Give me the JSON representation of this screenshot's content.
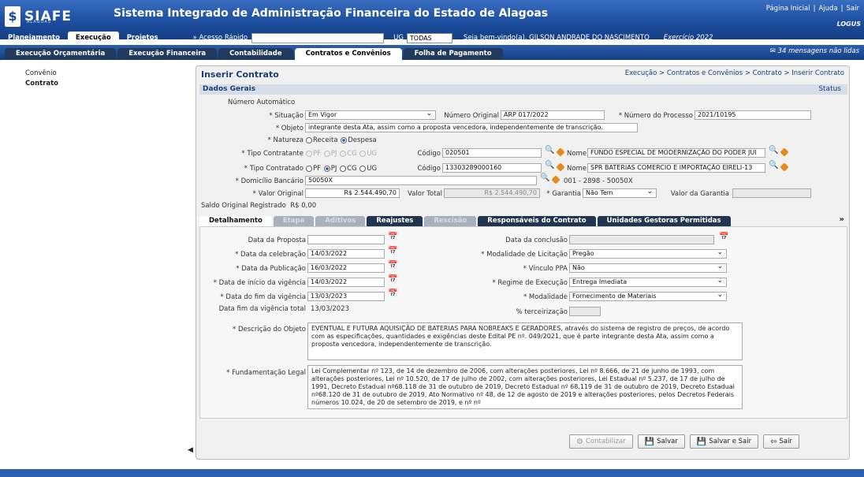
{
  "header": {
    "logo": "SIAFE",
    "logo_sub": "ALAGOAS",
    "title": "Sistema Integrado de Administração Financeira do Estado de Alagoas",
    "links": [
      "Página Inicial",
      "|",
      "Ajuda",
      "|",
      "Sair"
    ],
    "vendor": "LOGUS"
  },
  "menu": {
    "items": [
      "Planejamento",
      "Execução",
      "Projetos"
    ],
    "quick_access": "» Acesso Rápido",
    "ug_label": "UG",
    "ug_value": "TODAS",
    "welcome": "Seja bem-vindo(a), GILSON ANDRADE DO NASCIMENTO",
    "exercise": "Exercício 2022"
  },
  "tabs": [
    "Execução Orçamentária",
    "Execução Financeira",
    "Contabilidade",
    "Contratos e Convênios",
    "Folha de Pagamento"
  ],
  "messages": "34 mensagens não lidas",
  "leftnav": [
    "Convênio",
    "Contrato"
  ],
  "page": {
    "title": "Inserir Contrato",
    "breadcrumb": "Execução > Contratos e Convênios > Contrato > Inserir Contrato",
    "section": "Dados Gerais",
    "status_label": "Status"
  },
  "form": {
    "numero_auto": "Número Automático",
    "situacao_label": "* Situação",
    "situacao": "Em Vigor",
    "num_original_label": "Número Original",
    "num_original": "ARP 017/2022",
    "num_processo_label": "* Número do Processo",
    "num_processo": "2021/10195",
    "objeto_label": "* Objeto",
    "objeto": "integrante desta Ata, assim como a proposta vencedora, independentemente de transcrição.",
    "natureza_label": "* Natureza",
    "receita": "Receita",
    "despesa": "Despesa",
    "tipo_contratante_label": "* Tipo Contratante",
    "tipo_contratado_label": "* Tipo Contratado",
    "pf": "PF",
    "pj": "PJ",
    "cg": "CG",
    "ug": "UG",
    "codigo_label": "Código",
    "codigo1": "020501",
    "codigo2": "13303289000160",
    "nome_label": "Nome",
    "nome1": "FUNDO ESPECIAL DE MODERNIZAÇÃO DO PODER JUI",
    "nome2": "SPR BATERIAS COMERCIO E IMPORTAÇÃO EIRELI-13",
    "domicilio_label": "* Domicílio Bancário",
    "domicilio": "50050X",
    "domicilio_desc": "001 - 2898 - 50050X",
    "valor_original_label": "* Valor Original",
    "valor_original": "R$ 2.544.490,70",
    "valor_total_label": "Valor Total",
    "valor_total": "R$ 2.544.490,70",
    "garantia_label": "* Garantia",
    "garantia": "Não Tem",
    "valor_garantia_label": "Valor da Garantia",
    "saldo_label": "Saldo Original Registrado",
    "saldo": "R$ 0,00"
  },
  "subtabs": [
    "Detalhamento",
    "Etapa",
    "Aditivos",
    "Reajustes",
    "Rescisão",
    "Responsáveis do Contrato",
    "Unidades Gestoras Permitidas",
    "»"
  ],
  "detail": {
    "data_proposta_label": "Data da Proposta",
    "data_proposta": "",
    "data_celebracao_label": "* Data da celebração",
    "data_celebracao": "14/03/2022",
    "data_publicacao_label": "* Data da Publicação",
    "data_publicacao": "16/03/2022",
    "inicio_vigencia_label": "* Data de início da vigência",
    "inicio_vigencia": "14/03/2022",
    "fim_vigencia_label": "* Data do fim da vigência",
    "fim_vigencia": "13/03/2023",
    "fim_total_label": "Data fim da vigência total",
    "fim_total": "13/03/2023",
    "data_conclusao_label": "Data da conclusão",
    "data_conclusao": "",
    "modalidade_licitacao_label": "* Modalidade de Licitação",
    "modalidade_licitacao": "Pregão",
    "vinculo_ppa_label": "* Vínculo PPA",
    "vinculo_ppa": "Não",
    "regime_label": "* Regime de Execução",
    "regime": "Entrega Imediata",
    "modalidade_label": "* Modalidade",
    "modalidade": "Fornecimento de Materiais",
    "terceirizacao_label": "% terceirização",
    "terceirizacao": "",
    "descricao_label": "* Descrição do Objeto",
    "descricao": "EVENTUAL E FUTURA AQUISIÇÃO DE BATERIAS PARA NOBREAKS E GERADORES, através do sistema de registro de preços, de acordo com as especificações, quantidades e exigências deste Edital PE nº. 049/2021, que é parte integrante desta Ata, assim como a proposta vencedora, independentemente de transcrição.",
    "fundamentacao_label": "* Fundamentação Legal",
    "fundamentacao": "Lei Complementar nº 123, de 14 de dezembro de 2006, com alterações posteriores, Lei nº 8.666, de 21 de junho de 1993, com alterações posteriores, Lei nº 10.520, de 17 de julho de 2002, com alterações posteriores, Lei Estadual nº 5.237, de 17 de julho de 1991, Decreto Estadual nº68.118 de 31 de outubro de 2019, Decreto Estadual nº 68.119 de 31 de outubro de 2019, Decreto Estadual nº68.120 de 31 de outubro de 2019, Ato Normativo nº 48, de 12 de agosto de 2019 e alterações posteriores, pelos Decretos Federais números 10.024, de 20 de setembro de 2019, e nº nº"
  },
  "buttons": {
    "contabilizar": "Contabilizar",
    "salvar": "Salvar",
    "salvar_sair": "Salvar e Sair",
    "sair": "Sair"
  }
}
